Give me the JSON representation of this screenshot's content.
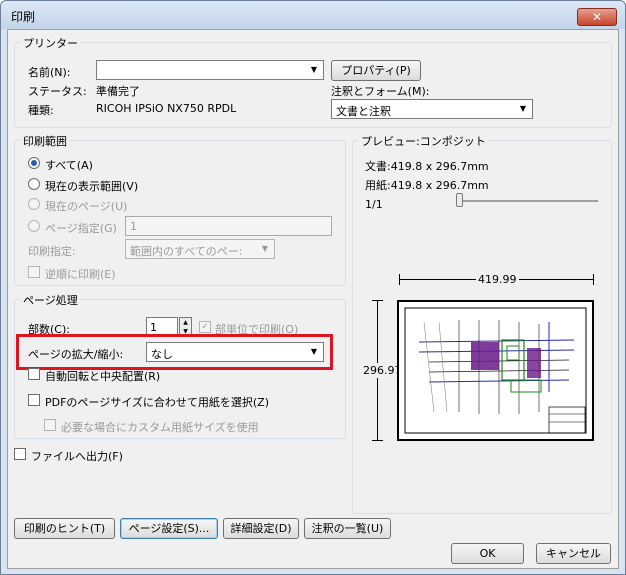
{
  "window": {
    "title": "印刷",
    "close_glyph": "✕"
  },
  "printer": {
    "legend": "プリンター",
    "name_label": "名前(N):",
    "name_value": "",
    "properties_button": "プロパティ(P)",
    "status_label": "ステータス:",
    "status_value": "準備完了",
    "type_label": "種類:",
    "type_value": "RICOH IPSiO NX750 RPDL",
    "annotations_label": "注釈とフォーム(M):",
    "annotations_value": "文書と注釈"
  },
  "range": {
    "legend": "印刷範囲",
    "all": "すべて(A)",
    "current_view": "現在の表示範囲(V)",
    "current_page": "現在のページ(U)",
    "pages": "ページ指定(G)",
    "pages_value": "1",
    "subset_label": "印刷指定:",
    "subset_value": "範囲内のすべてのペー:",
    "reverse": "逆順に印刷(E)"
  },
  "handling": {
    "legend": "ページ処理",
    "copies_label": "部数(C):",
    "copies_value": "1",
    "collate": "部単位で印刷(O)",
    "scaling_label": "ページの拡大/縮小:",
    "scaling_value": "なし",
    "auto_rotate": "自動回転と中央配置(R)",
    "choose_source": "PDFのページサイズに合わせて用紙を選択(Z)",
    "custom_paper": "必要な場合にカスタム用紙サイズを使用"
  },
  "print_to_file": "ファイルへ出力(F)",
  "preview": {
    "legend": "プレビュー:コンポジット",
    "document": "文書:419.8 x 296.7mm",
    "paper": "用紙:419.8 x 296.7mm",
    "page_counter": "1/1",
    "width_dim": "419.99",
    "height_dim": "296.97"
  },
  "buttons": {
    "tips": "印刷のヒント(T)",
    "page_setup": "ページ設定(S)...",
    "advanced": "詳細設定(D)",
    "summarize": "注釈の一覧(U)",
    "ok": "OK",
    "cancel": "キャンセル"
  }
}
